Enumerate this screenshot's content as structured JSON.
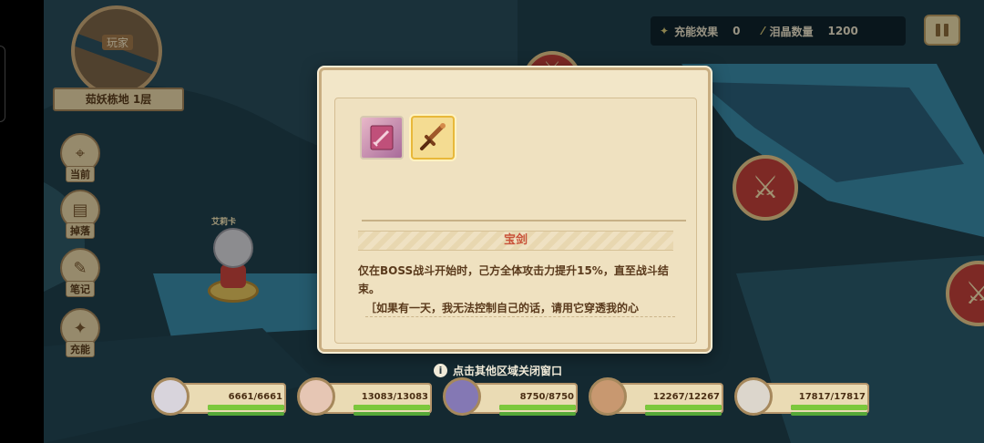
{
  "hud": {
    "charge_label": "充能效果",
    "charge_value": "0",
    "crystal_label": "泪晶数量",
    "crystal_value": "1200"
  },
  "minimap": {
    "label": "玩家",
    "floor": "茹妖栋地 1层"
  },
  "nav": [
    {
      "label": "当前",
      "icon": "location-icon"
    },
    {
      "label": "掉落",
      "icon": "book-icon"
    },
    {
      "label": "笔记",
      "icon": "notes-icon"
    },
    {
      "label": "充能",
      "icon": "charge-icon"
    }
  ],
  "map_character": {
    "name": "艾莉卡"
  },
  "dialog": {
    "items": [
      {
        "name": "book-item",
        "icon": "spellbook-icon"
      },
      {
        "name": "sword-item",
        "icon": "sword-icon",
        "selected": true
      }
    ],
    "item_title": "宝剑",
    "description": "仅在BOSS战斗开始时，己方全体攻击力提升15%，直至战斗结束。",
    "quote": "［如果有一天，我无法控制自己的话，请用它穿透我的心"
  },
  "hint": "点击其他区域关闭窗口",
  "party": [
    {
      "hp": "6661/6661",
      "hp_ratio": 1.0,
      "avatar_color": "#d8d4dc"
    },
    {
      "hp": "13083/13083",
      "hp_ratio": 1.0,
      "avatar_color": "#e6c6b4"
    },
    {
      "hp": "8750/8750",
      "hp_ratio": 1.0,
      "avatar_color": "#8478b4"
    },
    {
      "hp": "12267/12267",
      "hp_ratio": 1.0,
      "avatar_color": "#c89870"
    },
    {
      "hp": "17817/17817",
      "hp_ratio": 1.0,
      "avatar_color": "#dcd6cc"
    }
  ],
  "colors": {
    "dialog_bg": "#f2e6c8",
    "title_text": "#c9533a",
    "hp_green": "#7cc83c"
  }
}
